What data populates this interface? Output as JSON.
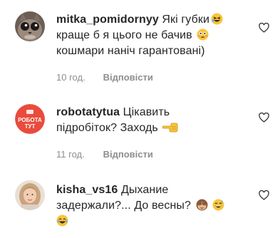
{
  "comments": [
    {
      "username": "mitka_pomidornyy",
      "lines": [
        "Які губки",
        "краще б я цього не бачив",
        "кошмари наніч гарантовані)"
      ],
      "emojis": [
        "rolling-laughing-emoji",
        "flushed-emoji"
      ],
      "time": "10 год.",
      "reply_label": "Відповісти",
      "avatar": "cat-avatar"
    },
    {
      "username": "robotatytua",
      "lines": [
        "Цікавить",
        "підробіток? Заходь"
      ],
      "emojis": [
        "pointing-left-emoji"
      ],
      "avatar_text": [
        "РОБОТА",
        "ТУТ"
      ],
      "avatar_color": "#e94b3c",
      "time": "11 год.",
      "reply_label": "Відповісти"
    },
    {
      "username": "kisha_vs16",
      "lines": [
        "Дыхание",
        "задержали?... До весны?",
        ""
      ],
      "emojis": [
        "see-no-evil-monkey-emoji",
        "grinning-sweat-emoji",
        "tears-of-joy-emoji"
      ],
      "avatar": "woman-avatar"
    }
  ],
  "colors": {
    "text": "#262626",
    "muted": "#8e8e8e",
    "emoji_yellow": "#f8c438"
  }
}
